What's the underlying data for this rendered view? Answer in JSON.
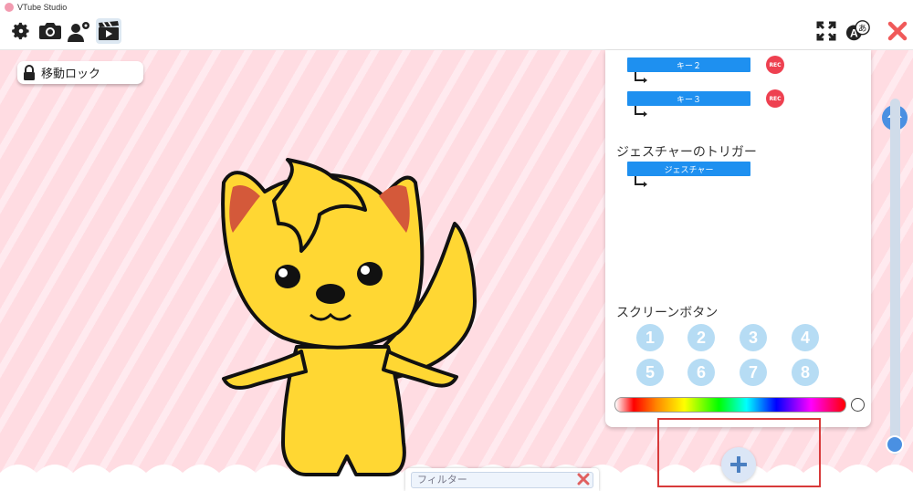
{
  "window": {
    "title": "VTube Studio"
  },
  "toolbar": {
    "settings_icon": "gear-icon",
    "camera_icon": "camera-icon",
    "model_icon": "user-gear-icon",
    "scene_icon": "clapperboard-icon",
    "fullscreen_icon": "expand-icon",
    "language_icon": "translate-icon",
    "close_icon": "close-icon"
  },
  "stage": {
    "lock_label": "移動ロック",
    "lock_icon": "lock-icon"
  },
  "panel": {
    "key_hotkeys": [
      {
        "label": "キー２",
        "rec": "REC"
      },
      {
        "label": "キー３",
        "rec": "REC"
      }
    ],
    "gesture_title": "ジェスチャーのトリガー",
    "gesture_button": "ジェスチャー",
    "screen_title": "スクリーンボタン",
    "screen_buttons": [
      "1",
      "2",
      "3",
      "4",
      "5",
      "6",
      "7",
      "8"
    ]
  },
  "filter": {
    "placeholder": "フィルター"
  },
  "colors": {
    "accent": "#1e90f0",
    "rec": "#ee4050",
    "close": "#f05a5a",
    "highlight": "#d83a3a"
  }
}
